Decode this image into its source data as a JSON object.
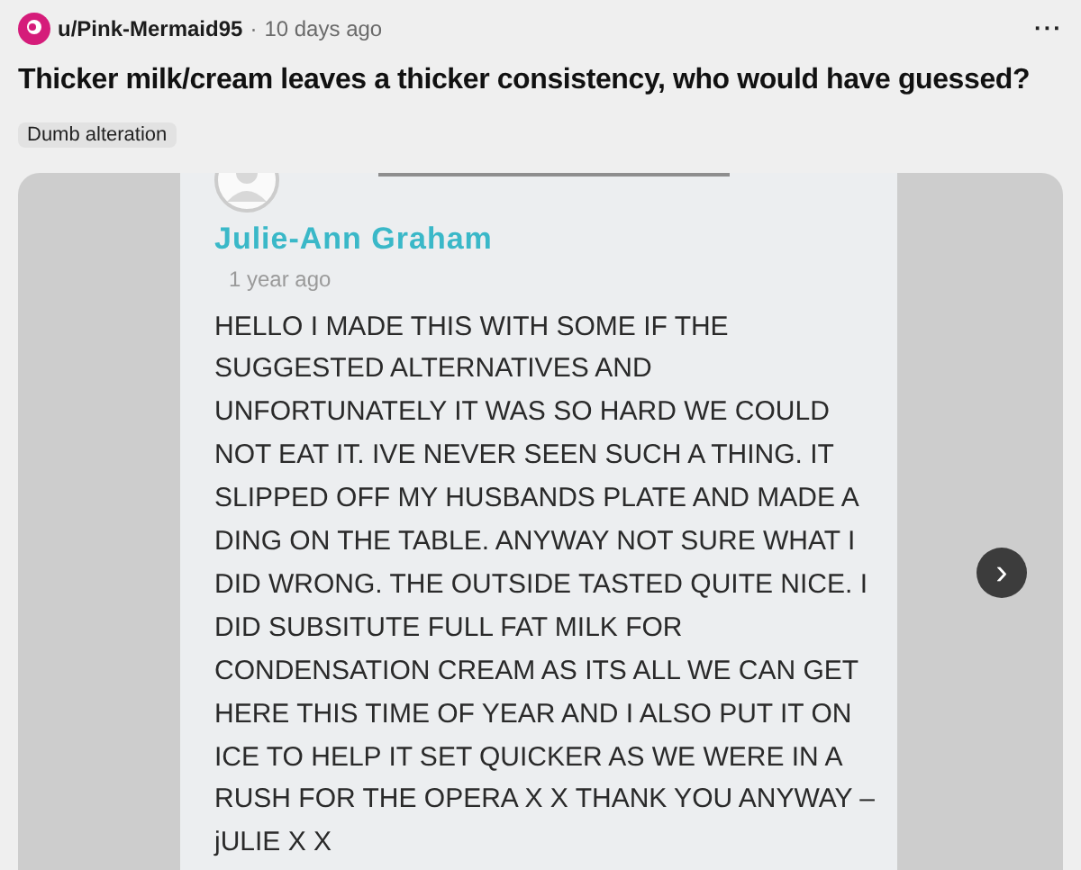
{
  "post": {
    "author": "u/Pink-Mermaid95",
    "separator": "·",
    "time": "10 days ago",
    "menu": "···",
    "title": "Thicker milk/cream leaves a thicker consistency, who would have guessed?",
    "flair": "Dumb alteration"
  },
  "comment": {
    "name": "Julie-Ann Graham",
    "time": "1 year ago",
    "body_lines": [
      "HELLO I MADE THIS WITH SOME IF THE",
      "SUGGESTED ALTERNATIVES AND",
      "UNFORTUNATELY IT WAS SO HARD WE COULD",
      "NOT EAT IT. IVE NEVER SEEN SUCH A THING. IT",
      "SLIPPED OFF MY HUSBANDS PLATE AND MADE A",
      "DING ON THE TABLE. ANYWAY NOT SURE WHAT I",
      "DID WRONG. THE OUTSIDE TASTED QUITE NICE. I",
      "DID SUBSITUTE FULL FAT MILK FOR",
      "CONDENSATION CREAM AS ITS ALL WE CAN GET",
      "HERE THIS TIME OF YEAR AND I ALSO PUT IT ON",
      "ICE TO HELP IT SET QUICKER AS WE WERE IN A",
      "RUSH FOR THE OPERA X X THANK YOU ANYWAY –",
      "jULIE X X"
    ]
  },
  "carousel": {
    "next": "›"
  }
}
